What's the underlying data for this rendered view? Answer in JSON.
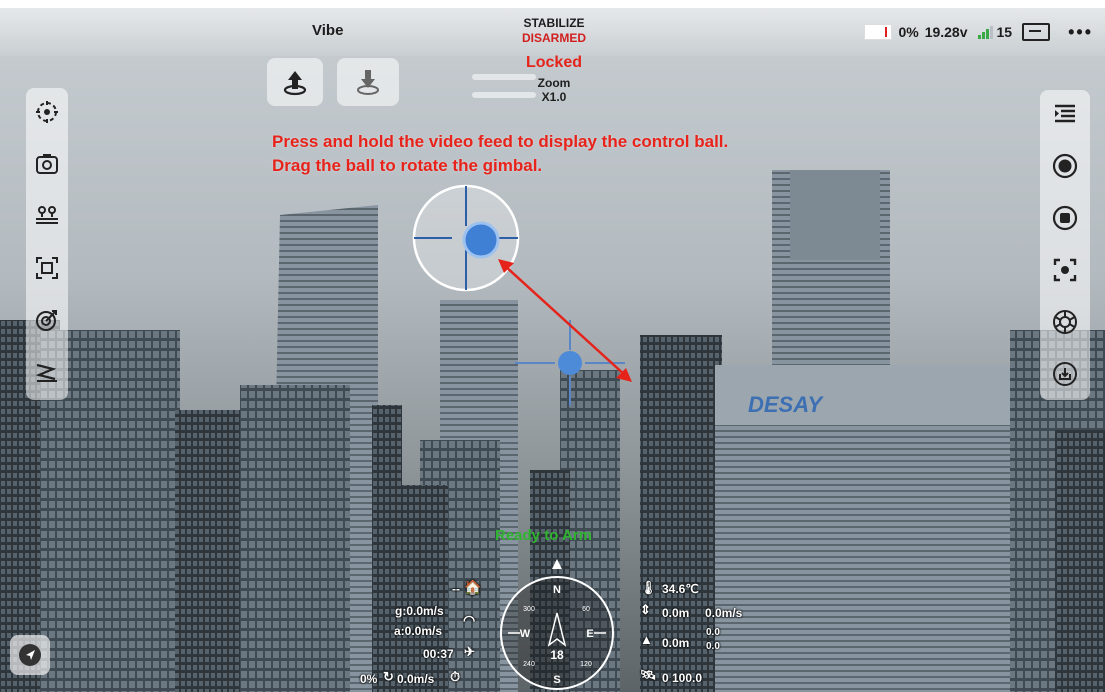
{
  "header": {
    "vehicle_name": "Vibe",
    "flight_mode": "STABILIZE",
    "arm_state": "DISARMED",
    "battery_percent": "0%",
    "battery_voltage": "19.28v",
    "satellite_count": "15",
    "menu_label": "•••"
  },
  "gimbal": {
    "lock_state": "Locked",
    "zoom_label": "Zoom",
    "zoom_value": "X1.0"
  },
  "hint": {
    "line1": "Press and hold the video feed to display the control ball.",
    "line2": "Drag the ball to rotate the gimbal."
  },
  "status": {
    "ready_message": "Ready to Arm"
  },
  "telemetry": {
    "home_distance": "--",
    "ground_speed": "g:0.0m/s",
    "air_speed": "a:0.0m/s",
    "flight_time": "00:37",
    "throttle": "0%",
    "vertical_speed": "0.0m/s",
    "temperature": "34.6℃",
    "relative_height": "0.0m",
    "height_speed": "0.0m/s",
    "altitude": "0.0m",
    "alt_sub_top": "0.0",
    "alt_sub_bottom": "0.0",
    "gps_readout": "0 100.0"
  },
  "compass": {
    "north": "N",
    "south": "S",
    "east": "E",
    "west": "W",
    "heading": "18",
    "tick_nw": "300",
    "tick_ne": "60",
    "tick_sw": "240",
    "tick_se": "120"
  },
  "colors": {
    "accent_red": "#e5231b",
    "ready_green": "#2fb42f",
    "control_ball": "#3f7fd4"
  },
  "icons": {
    "top_left": [
      "takeoff-icon",
      "land-icon"
    ],
    "left_bar": [
      "gimbal-center-icon",
      "camera-switch-icon",
      "waypoint-icon",
      "zoom-frame-icon",
      "target-icon",
      "fly-mode-icon"
    ],
    "right_bar": [
      "menu-collapse-icon",
      "record-icon",
      "stop-icon",
      "focus-icon",
      "aperture-icon",
      "download-icon"
    ]
  }
}
